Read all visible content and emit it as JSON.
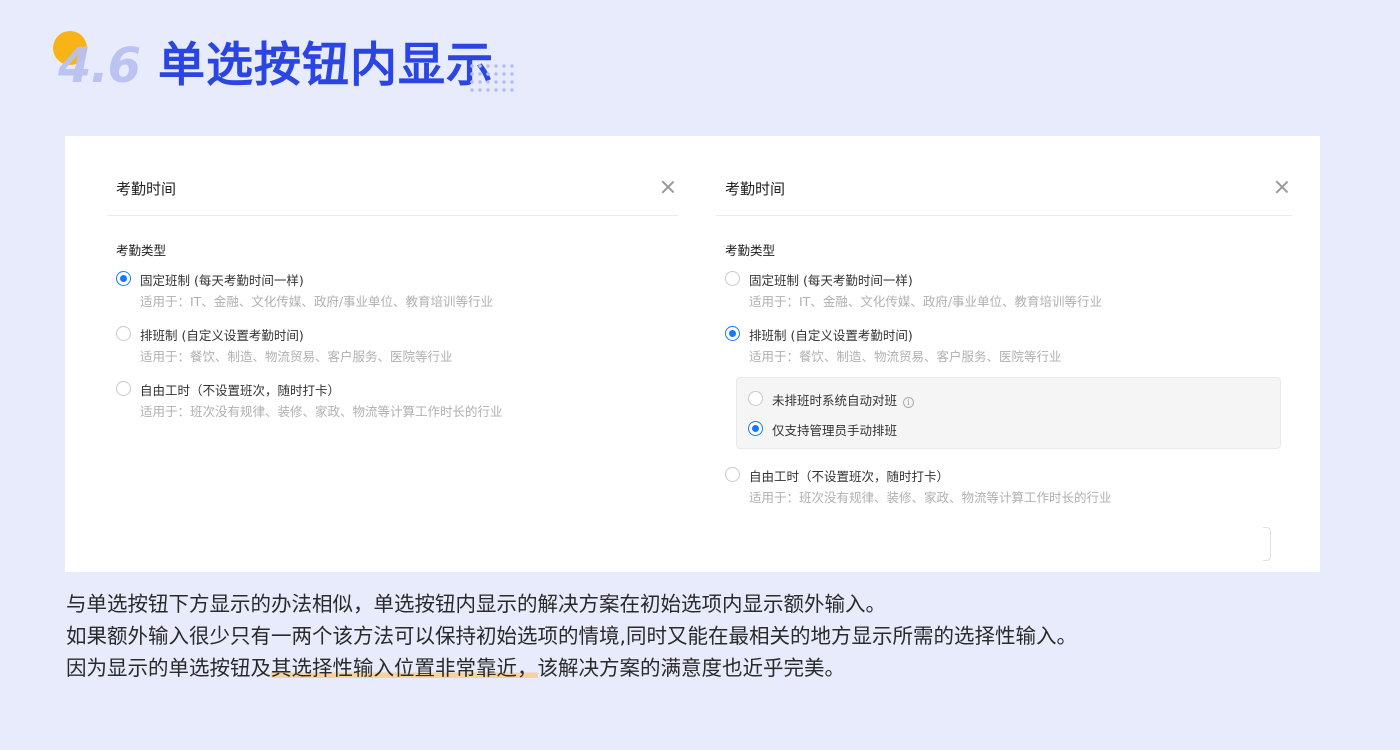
{
  "heading": {
    "number": "4.6",
    "title": "单选按钮内显示"
  },
  "panels": [
    {
      "title": "考勤时间",
      "section_label": "考勤类型",
      "options": [
        {
          "label": "固定班制 (每天考勤时间一样)",
          "desc": "适用于：IT、金融、文化传媒、政府/事业单位、教育培训等行业",
          "selected": true
        },
        {
          "label": "排班制 (自定义设置考勤时间)",
          "desc": "适用于：餐饮、制造、物流贸易、客户服务、医院等行业",
          "selected": false
        },
        {
          "label": "自由工时（不设置班次，随时打卡）",
          "desc": "适用于：班次没有规律、装修、家政、物流等计算工作时长的行业",
          "selected": false
        }
      ]
    },
    {
      "title": "考勤时间",
      "section_label": "考勤类型",
      "options": [
        {
          "label": "固定班制 (每天考勤时间一样)",
          "desc": "适用于：IT、金融、文化传媒、政府/事业单位、教育培训等行业",
          "selected": false
        },
        {
          "label": "排班制 (自定义设置考勤时间)",
          "desc": "适用于：餐饮、制造、物流贸易、客户服务、医院等行业",
          "selected": true
        },
        {
          "label": "自由工时（不设置班次，随时打卡）",
          "desc": "适用于：班次没有规律、装修、家政、物流等计算工作时长的行业",
          "selected": false
        }
      ],
      "sub_options": [
        {
          "label": "未排班时系统自动对班",
          "selected": false
        },
        {
          "label": "仅支持管理员手动排班",
          "selected": true
        }
      ]
    }
  ],
  "description": {
    "line1": "与单选按钮下方显示的办法相似，单选按钮内显示的解决方案在初始选项内显示额外输入。",
    "line2": "如果额外输入很少只有一两个该方法可以保持初始选项的情境,同时又能在最相关的地方显示所需的选择性输入。",
    "line3_pre": "因为显示的单选按钮及",
    "line3_highlight": "其选择性输入位置非常靠近，",
    "line3_post": "该解决方案的满意度也近乎完美。"
  },
  "colors": {
    "accent": "#1677ff",
    "heading": "#2b45e3",
    "badge": "#f8b316",
    "background": "#e8ebfb",
    "highlight": "#f3d49c"
  },
  "icons": [
    "close-icon",
    "info-icon",
    "radio-icon"
  ]
}
